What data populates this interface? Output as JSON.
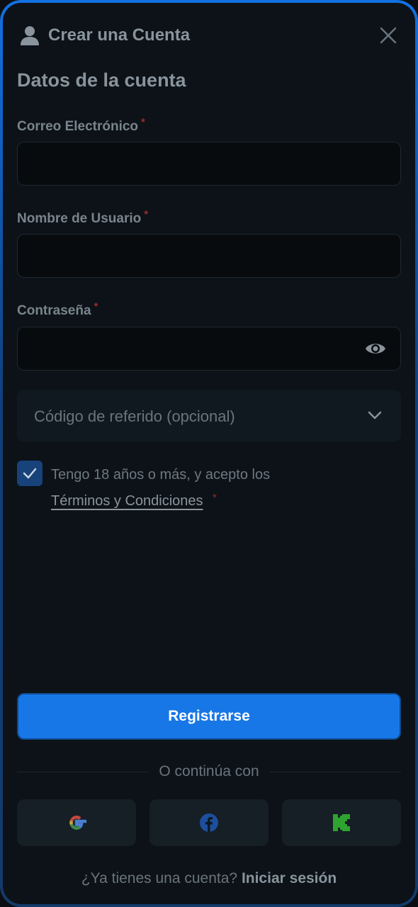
{
  "header": {
    "title": "Crear una Cuenta"
  },
  "section_title": "Datos de la cuenta",
  "fields": {
    "email": {
      "label": "Correo Electrónico",
      "required": "*",
      "value": ""
    },
    "username": {
      "label": "Nombre de Usuario",
      "required": "*",
      "value": ""
    },
    "password": {
      "label": "Contraseña",
      "required": "*",
      "value": ""
    }
  },
  "referral": {
    "label": "Código de referido (opcional)"
  },
  "agreement": {
    "text": "Tengo 18 años o más, y acepto los",
    "link": "Términos y Condiciones",
    "required": "*",
    "checked": true
  },
  "register_button": "Registrarse",
  "divider": "O continúa con",
  "social": [
    "google-icon",
    "facebook-icon",
    "kick-icon"
  ],
  "footer": {
    "question": "¿Ya tienes una cuenta?",
    "link": "Iniciar sesión"
  },
  "colors": {
    "accent": "#1877e6",
    "background": "#0c1218",
    "frame": "#1270e3"
  }
}
